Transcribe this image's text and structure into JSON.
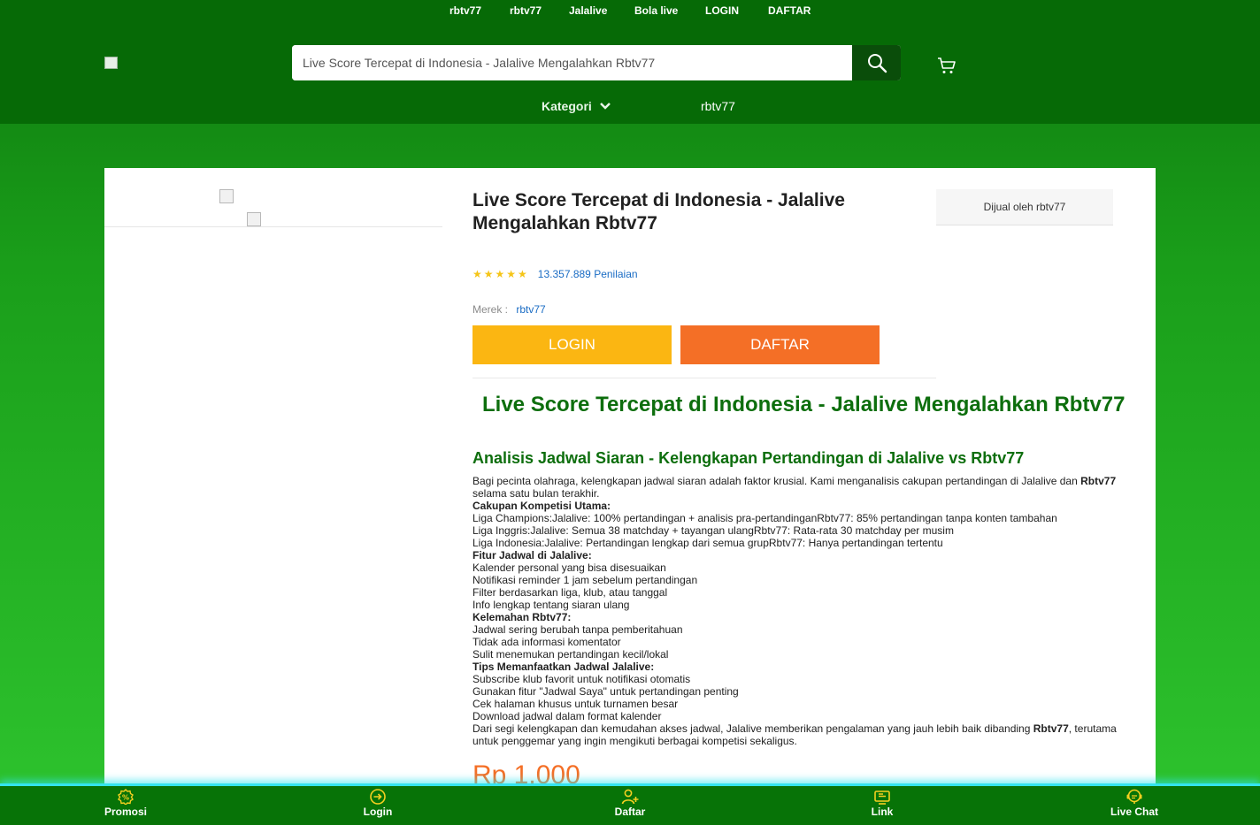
{
  "top_links": [
    "rbtv77",
    "rbtv77",
    "Jalalive",
    "Bola live",
    "LOGIN",
    "DAFTAR"
  ],
  "search": {
    "value": "Live Score Tercepat di Indonesia - Jalalive Mengalahkan Rbtv77"
  },
  "nav": {
    "kategori": "Kategori",
    "link": "rbtv77"
  },
  "product": {
    "title": "Live Score Tercepat di Indonesia - Jalalive Mengalahkan Rbtv77",
    "stars": "★★★★★",
    "rating_count": "13.357.889 Penilaian",
    "merek_label": "Merek :",
    "merek_value": "rbtv77",
    "login_label": "LOGIN",
    "daftar_label": "DAFTAR",
    "seller": "Dijual oleh rbtv77",
    "price": "Rp 1.000"
  },
  "article": {
    "heading": "Live Score Tercepat di Indonesia - Jalalive Mengalahkan Rbtv77",
    "subheading": "Analisis Jadwal Siaran - Kelengkapan Pertandingan di Jalalive vs Rbtv77",
    "intro_a": "Bagi pecinta olahraga, kelengkapan jadwal siaran adalah faktor krusial. Kami menganalisis cakupan pertandingan di Jalalive dan ",
    "intro_b": "Rbtv77",
    "intro_c": " selama satu bulan terakhir.",
    "s1": "Cakupan Kompetisi Utama:",
    "l1": "Liga Champions:Jalalive: 100% pertandingan + analisis pra-pertandinganRbtv77: 85% pertandingan tanpa konten tambahan",
    "l2": "Liga Inggris:Jalalive: Semua 38 matchday + tayangan ulangRbtv77: Rata-rata 30 matchday per musim",
    "l3": "Liga Indonesia:Jalalive: Pertandingan lengkap dari semua grupRbtv77: Hanya pertandingan tertentu",
    "s2": "Fitur Jadwal di Jalalive:",
    "l4": "Kalender personal yang bisa disesuaikan",
    "l5": "Notifikasi reminder 1 jam sebelum pertandingan",
    "l6": "Filter berdasarkan liga, klub, atau tanggal",
    "l7": "Info lengkap tentang siaran ulang",
    "s3": "Kelemahan Rbtv77:",
    "l8": "Jadwal sering berubah tanpa pemberitahuan",
    "l9": "Tidak ada informasi komentator",
    "l10": "Sulit menemukan pertandingan kecil/lokal",
    "s4": "Tips Memanfaatkan Jadwal Jalalive:",
    "l11": "Subscribe klub favorit untuk notifikasi otomatis",
    "l12": "Gunakan fitur \"Jadwal Saya\" untuk pertandingan penting",
    "l13": "Cek halaman khusus untuk turnamen besar",
    "l14": "Download jadwal dalam format kalender",
    "outro_a": "Dari segi kelengkapan dan kemudahan akses jadwal, Jalalive memberikan pengalaman yang jauh lebih baik dibanding ",
    "outro_b": "Rbtv77",
    "outro_c": ", terutama untuk penggemar yang ingin mengikuti berbagai kompetisi sekaligus."
  },
  "bottom_nav": [
    "Promosi",
    "Login",
    "Daftar",
    "Link",
    "Live Chat"
  ],
  "colors": {
    "header": "#066a06",
    "accent_green": "#0d6e0d",
    "login_button": "#fbb612",
    "daftar_button": "#f46f26",
    "link_blue": "#1a6cc4",
    "bottom_bar_glow": "#33e4ee"
  },
  "icons": [
    "search-icon",
    "cart-icon",
    "chevron-down-icon",
    "promo-icon",
    "login-icon",
    "register-icon",
    "link-icon",
    "chat-icon"
  ]
}
